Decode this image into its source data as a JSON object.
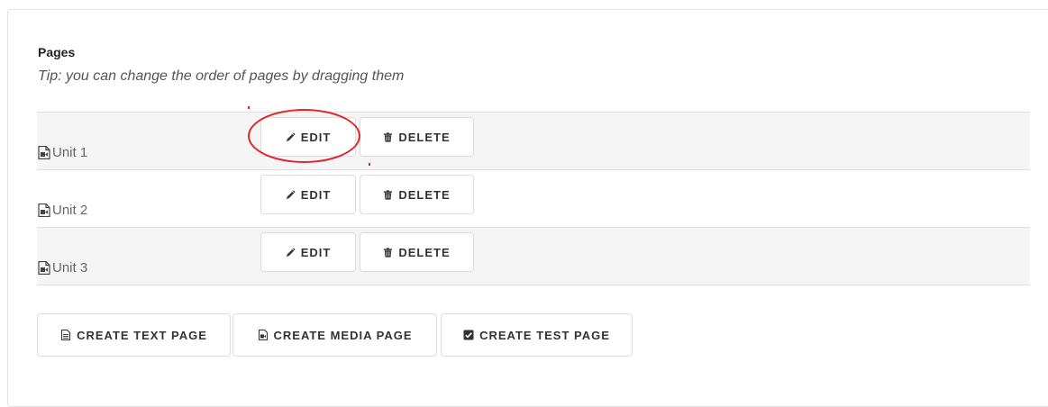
{
  "section": {
    "title": "Pages",
    "tip": "Tip: you can change the order of pages by dragging them"
  },
  "pages": [
    {
      "name": "Unit 1",
      "edit_label": "EDIT",
      "delete_label": "DELETE"
    },
    {
      "name": "Unit 2",
      "edit_label": "EDIT",
      "delete_label": "DELETE"
    },
    {
      "name": "Unit 3",
      "edit_label": "EDIT",
      "delete_label": "DELETE"
    }
  ],
  "create_buttons": {
    "text_page": "CREATE TEXT PAGE",
    "media_page": "CREATE MEDIA PAGE",
    "test_page": "CREATE TEST PAGE"
  },
  "icons": {
    "page": "media-file-icon",
    "edit": "pencil-icon",
    "delete": "trash-icon",
    "text_page": "text-file-icon",
    "media_page": "media-file-icon",
    "test_page": "checkbox-icon"
  },
  "colors": {
    "annotation": "#e0242a",
    "row_shade": "#f5f5f5"
  }
}
